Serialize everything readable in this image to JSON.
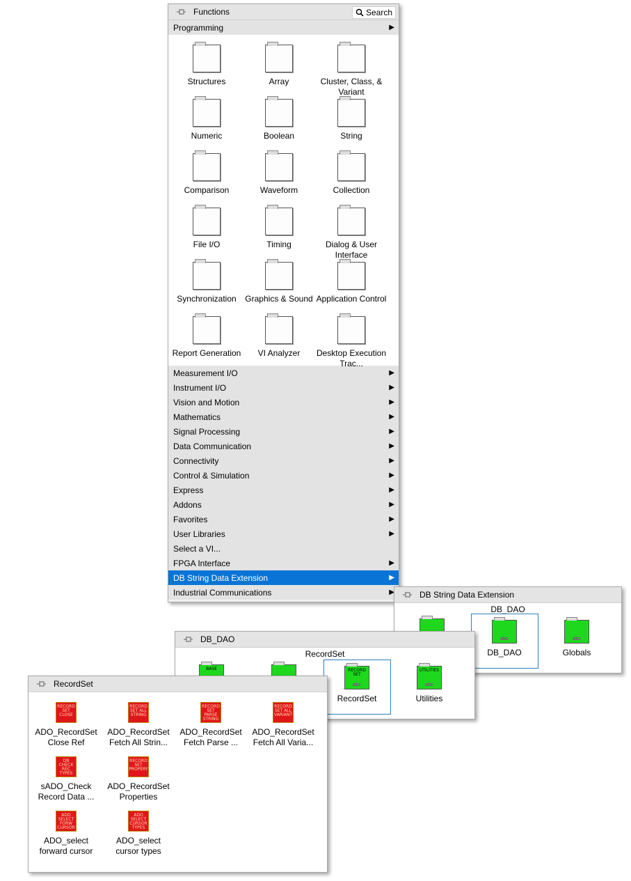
{
  "functions": {
    "title": "Functions",
    "search_label": "Search",
    "programming_label": "Programming",
    "icons": [
      {
        "label": "Structures",
        "icon": "structures-icon"
      },
      {
        "label": "Array",
        "icon": "array-icon"
      },
      {
        "label": "Cluster, Class, & Variant",
        "icon": "cluster-icon"
      },
      {
        "label": "Numeric",
        "icon": "numeric-icon"
      },
      {
        "label": "Boolean",
        "icon": "boolean-icon"
      },
      {
        "label": "String",
        "icon": "string-icon"
      },
      {
        "label": "Comparison",
        "icon": "comparison-icon"
      },
      {
        "label": "Waveform",
        "icon": "waveform-icon"
      },
      {
        "label": "Collection",
        "icon": "collection-icon"
      },
      {
        "label": "File I/O",
        "icon": "file-io-icon"
      },
      {
        "label": "Timing",
        "icon": "timing-icon"
      },
      {
        "label": "Dialog & User Interface",
        "icon": "dialog-icon"
      },
      {
        "label": "Synchronization",
        "icon": "synchronization-icon"
      },
      {
        "label": "Graphics & Sound",
        "icon": "graphics-sound-icon"
      },
      {
        "label": "Application Control",
        "icon": "application-control-icon"
      },
      {
        "label": "Report Generation",
        "icon": "report-generation-icon"
      },
      {
        "label": "VI Analyzer",
        "icon": "vi-analyzer-icon"
      },
      {
        "label": "Desktop Execution Trac...",
        "icon": "desktop-execution-icon"
      }
    ],
    "categories": [
      {
        "label": "Measurement I/O",
        "arrow": true
      },
      {
        "label": "Instrument I/O",
        "arrow": true
      },
      {
        "label": "Vision and Motion",
        "arrow": true
      },
      {
        "label": "Mathematics",
        "arrow": true
      },
      {
        "label": "Signal Processing",
        "arrow": true
      },
      {
        "label": "Data Communication",
        "arrow": true
      },
      {
        "label": "Connectivity",
        "arrow": true
      },
      {
        "label": "Control & Simulation",
        "arrow": true
      },
      {
        "label": "Express",
        "arrow": true
      },
      {
        "label": "Addons",
        "arrow": true
      },
      {
        "label": "Favorites",
        "arrow": true
      },
      {
        "label": "User Libraries",
        "arrow": true
      },
      {
        "label": "Select a VI...",
        "arrow": false
      },
      {
        "label": "FPGA Interface",
        "arrow": true
      },
      {
        "label": "DB String Data Extension",
        "arrow": true,
        "selected": true
      },
      {
        "label": "Industrial Communications",
        "arrow": true
      }
    ]
  },
  "db_string": {
    "title": "DB String Data Extension",
    "header": "DB_DAO",
    "items": [
      {
        "label": "DB_DAO",
        "icon_text": "",
        "selected": true
      },
      {
        "label": "Globals",
        "icon_text": ""
      }
    ]
  },
  "db_dao": {
    "title": "DB_DAO",
    "header": "RecordSet",
    "items": [
      {
        "label": "BASE",
        "icon_text": "BASE"
      },
      {
        "label": "",
        "icon_text": ""
      },
      {
        "label": "RecordSet",
        "icon_text": "RECORD SET",
        "selected": true
      },
      {
        "label": "Utilities",
        "icon_text": "UTILITIES"
      }
    ]
  },
  "recordset": {
    "title": "RecordSet",
    "items": [
      {
        "label1": "ADO_RecordSet",
        "label2": "Close Ref",
        "icon_text": "RECORD SET CLOSE"
      },
      {
        "label1": "ADO_RecordSet",
        "label2": "Fetch All Strin...",
        "icon_text": "RECORD SET ALL STRING"
      },
      {
        "label1": "ADO_RecordSet",
        "label2": "Fetch Parse ...",
        "icon_text": "RECORD SET PARSE STRING"
      },
      {
        "label1": "ADO_RecordSet",
        "label2": "Fetch All Varia...",
        "icon_text": "RECORD SET ALL VARIANT"
      },
      {
        "label1": "sADO_Check",
        "label2": "Record Data ...",
        "icon_text": "DB CHECK REC TYPES"
      },
      {
        "label1": "ADO_RecordSet",
        "label2": "Properties",
        "icon_text": "RECORD SET PROPERY"
      },
      {
        "label1": "ADO_select",
        "label2": "forward cursor",
        "icon_text": "ADO SELECT FORW CURSOR"
      },
      {
        "label1": "ADO_select",
        "label2": "cursor types",
        "icon_text": "ADO SELECT CURSOR TYPES"
      }
    ]
  },
  "colors": {
    "selected_row": "#0a74d6",
    "green_vi": "#1ed81e",
    "red_vi": "#e0161a"
  }
}
